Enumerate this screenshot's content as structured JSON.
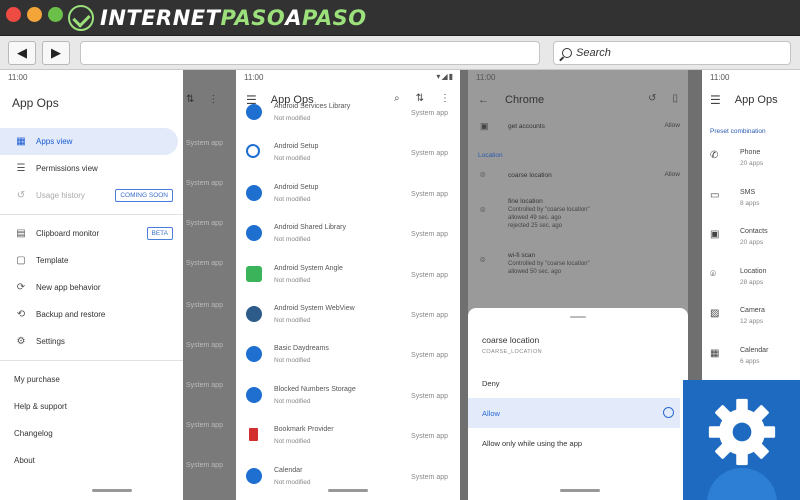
{
  "browser": {
    "logo_text_1": "INTERNET",
    "logo_text_2": "PASO",
    "logo_text_3": "A",
    "logo_text_4": "PASO",
    "back_glyph": "◀",
    "forward_glyph": "▶",
    "search_placeholder": "Search"
  },
  "status_time": "11:00",
  "panel1": {
    "title": "App Ops",
    "items": [
      {
        "label": "Apps view",
        "icon": "grid-icon"
      },
      {
        "label": "Permissions view",
        "icon": "list-icon"
      },
      {
        "label": "Usage history",
        "icon": "history-icon",
        "chip": "COMING SOON"
      },
      {
        "label": "Clipboard monitor",
        "icon": "clipboard-icon",
        "chip": "BETA"
      },
      {
        "label": "Template",
        "icon": "template-icon"
      },
      {
        "label": "New app behavior",
        "icon": "sync-icon"
      },
      {
        "label": "Backup and restore",
        "icon": "restore-icon"
      },
      {
        "label": "Settings",
        "icon": "gear-icon"
      }
    ],
    "links": [
      "My purchase",
      "Help & support",
      "Changelog",
      "About"
    ],
    "under_label": "System app"
  },
  "panel2": {
    "title": "App Ops",
    "rows": [
      {
        "name": "Android Services Library",
        "sub": "Not modified",
        "tag": "System app"
      },
      {
        "name": "Android Setup",
        "sub": "Not modified",
        "tag": "System app"
      },
      {
        "name": "Android Setup",
        "sub": "Not modified",
        "tag": "System app"
      },
      {
        "name": "Android Shared Library",
        "sub": "Not modified",
        "tag": "System app"
      },
      {
        "name": "Android System Angle",
        "sub": "Not modified",
        "tag": "System app"
      },
      {
        "name": "Android System WebView",
        "sub": "Not modified",
        "tag": "System app"
      },
      {
        "name": "Basic Daydreams",
        "sub": "Not modified",
        "tag": "System app"
      },
      {
        "name": "Blocked Numbers Storage",
        "sub": "Not modified",
        "tag": "System app"
      },
      {
        "name": "Bookmark Provider",
        "sub": "Not modified",
        "tag": "System app"
      },
      {
        "name": "Calendar",
        "sub": "Not modified",
        "tag": "System app"
      }
    ]
  },
  "panel3": {
    "title": "Chrome",
    "top_row": {
      "label": "get accounts",
      "state": "Allow"
    },
    "section": "Location",
    "rows": [
      {
        "label": "coarse location",
        "state": "Allow",
        "l2": "",
        "l3": ""
      },
      {
        "label": "fine location",
        "state": "",
        "l2": "Controlled by \"coarse location\"",
        "l3": "allowed 49 sec. ago",
        "l4": "rejected 25 sec. ago"
      },
      {
        "label": "wi-fi scan",
        "state": "",
        "l2": "Controlled by \"coarse location\"",
        "l3": "allowed 50 sec. ago",
        "l4": ""
      }
    ],
    "sheet": {
      "title": "coarse location",
      "subtitle": "COARSE_LOCATION",
      "options": [
        "Deny",
        "Allow",
        "Allow only while using the app"
      ],
      "selected_index": 1
    }
  },
  "panel4": {
    "title": "App Ops",
    "section": "Preset combination",
    "rows": [
      {
        "name": "Phone",
        "count": "20 apps",
        "icon": "phone-icon"
      },
      {
        "name": "SMS",
        "count": "8 apps",
        "icon": "sms-icon"
      },
      {
        "name": "Contacts",
        "count": "20 apps",
        "icon": "contacts-icon"
      },
      {
        "name": "Location",
        "count": "28 apps",
        "icon": "location-icon"
      },
      {
        "name": "Camera",
        "count": "12 apps",
        "icon": "camera-icon"
      },
      {
        "name": "Calendar",
        "count": "6 apps",
        "icon": "calendar-icon"
      }
    ]
  },
  "colors": {
    "accent": "#1a5bd0",
    "badge": "#1e6ac0",
    "logo_green": "#9be07b"
  }
}
